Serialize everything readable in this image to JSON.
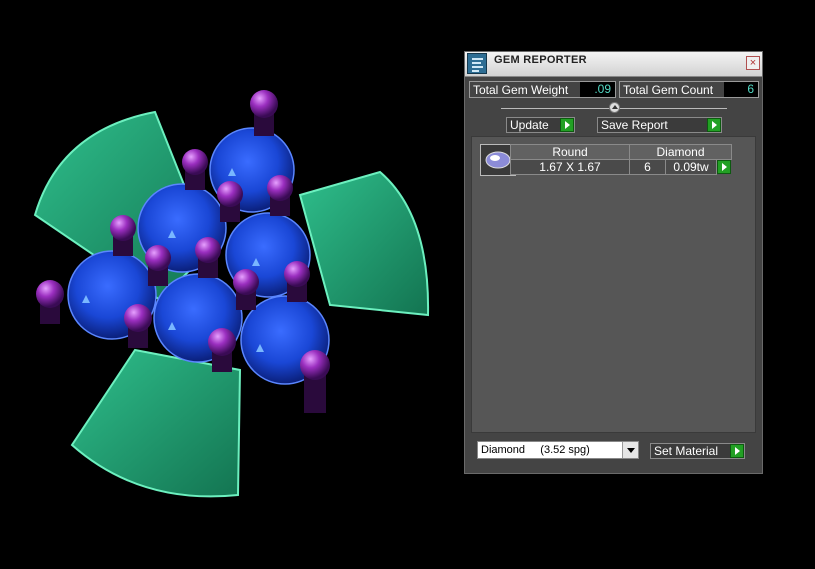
{
  "panel": {
    "title": "GEM REPORTER",
    "close_label": "×",
    "total_weight_label": "Total Gem Weight",
    "total_weight_value": ".09",
    "total_count_label": "Total Gem Count",
    "total_count_value": "6",
    "update_label": "Update",
    "save_report_label": "Save Report",
    "gem_table": {
      "headers": [
        "Round",
        "Diamond"
      ],
      "rows": [
        {
          "size": "1.67 X 1.67",
          "count": "6",
          "weight": "0.09tw"
        }
      ]
    },
    "material_select": "Diamond     (3.52 spg)",
    "set_material_label": "Set Material"
  },
  "colors": {
    "accent_teal": "#52d9c4",
    "go_green": "#22a024",
    "gem_blue": "#1a47d6",
    "prong_purple": "#9b2fc0",
    "setting_green": "#1f9a6e"
  }
}
